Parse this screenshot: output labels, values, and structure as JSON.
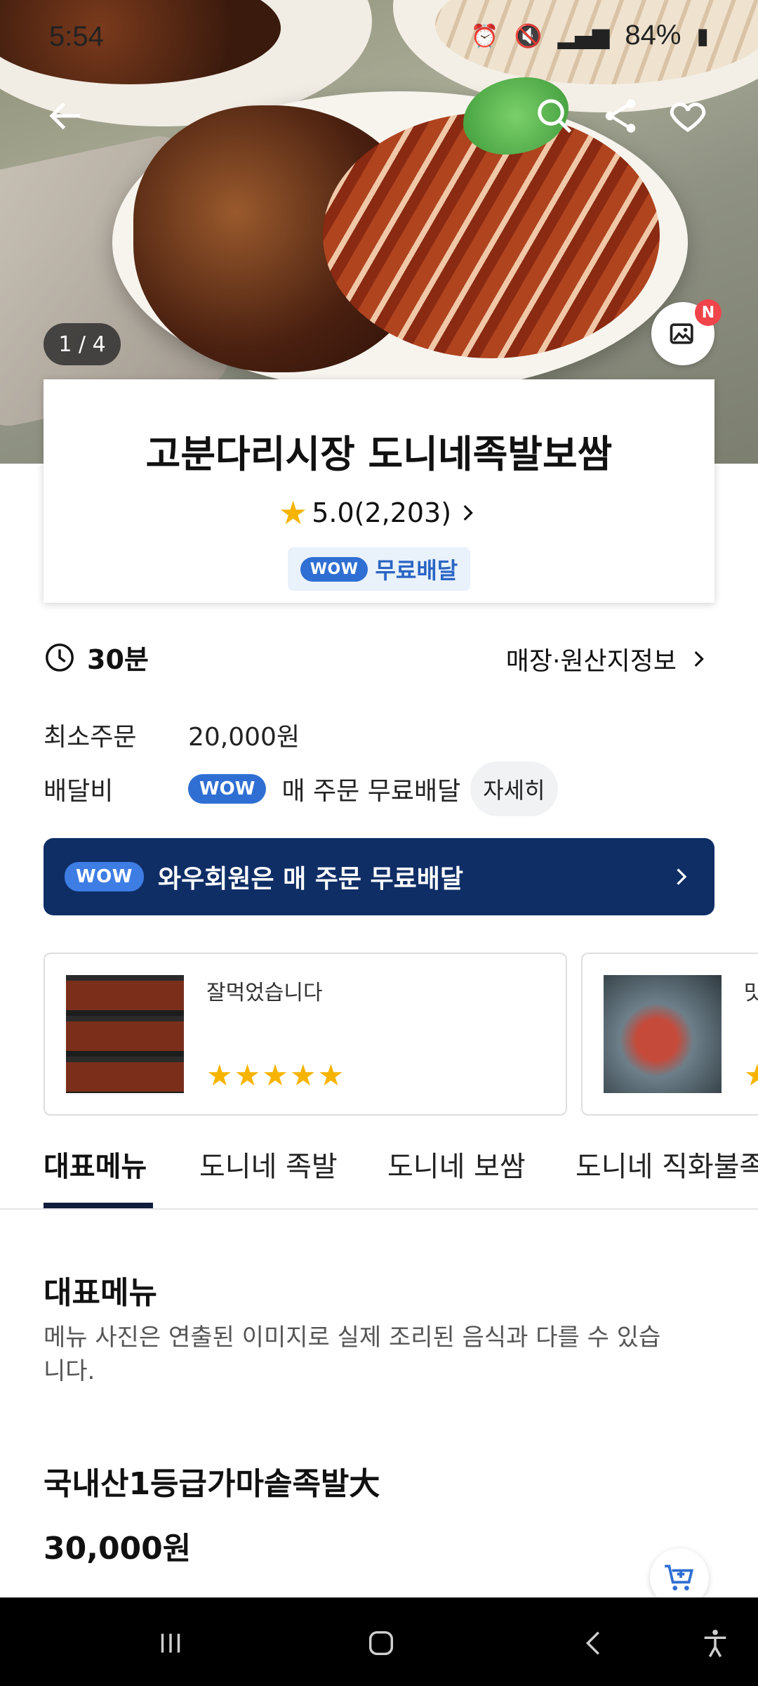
{
  "status_bar": {
    "time": "5:54",
    "battery": "84%"
  },
  "hero": {
    "page_indicator": "1 / 4",
    "photo_review_badge": "N"
  },
  "store": {
    "name": "고분다리시장 도니네족발보쌈",
    "rating": "5.0(2,203)",
    "wow_badge": "WOW",
    "free_delivery": "무료배달"
  },
  "info": {
    "delivery_time": "30분",
    "origin_link": "매장·원산지정보",
    "min_order_label": "최소주문",
    "min_order_value": "20,000원",
    "delivery_fee_label": "배달비",
    "delivery_fee_badge": "WOW",
    "delivery_fee_value": "매 주문 무료배달",
    "detail_button": "자세히"
  },
  "wow_banner": {
    "badge": "WOW",
    "text": "와우회원은 매 주문 무료배달"
  },
  "reviews": [
    {
      "text": "잘먹었습니다",
      "stars": "★★★★★"
    },
    {
      "text": "맛",
      "stars": "★"
    }
  ],
  "tabs": [
    "대표메뉴",
    "도니네 족발",
    "도니네 보쌈",
    "도니네 직화불족"
  ],
  "menu_section": {
    "title": "대표메뉴",
    "description": "메뉴 사진은 연출된 이미지로 실제 조리된 음식과 다를 수 있습니다."
  },
  "menu_item": {
    "name": "국내산1등급가마솥족발大",
    "price": "30,000원"
  },
  "colors": {
    "wow_blue": "#2f6fd3",
    "banner_navy": "#0f2e66",
    "star_yellow": "#f6b400",
    "badge_red": "#f0444a"
  }
}
